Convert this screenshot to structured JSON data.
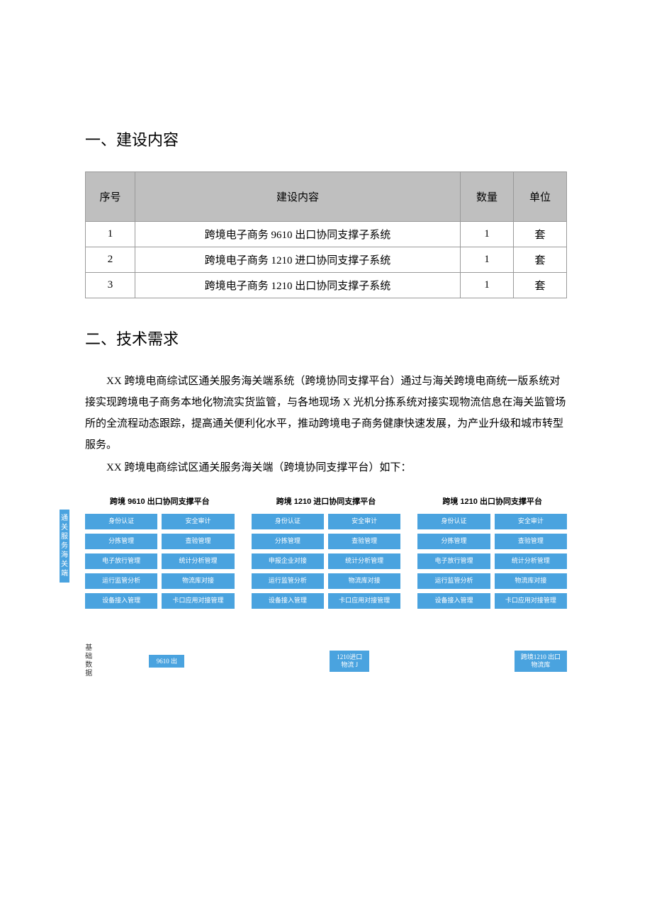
{
  "heading1": "一、建设内容",
  "table": {
    "headers": {
      "seq": "序号",
      "content": "建设内容",
      "qty": "数量",
      "unit": "单位"
    },
    "rows": [
      {
        "seq": "1",
        "content": "跨境电子商务 9610 出口协同支撑子系统",
        "qty": "1",
        "unit": "套"
      },
      {
        "seq": "2",
        "content": "跨境电子商务 1210 进口协同支撑子系统",
        "qty": "1",
        "unit": "套"
      },
      {
        "seq": "3",
        "content": "跨境电子商务 1210 出口协同支撑子系统",
        "qty": "1",
        "unit": "套"
      }
    ]
  },
  "heading2": "二、技术需求",
  "para1": "XX 跨境电商综试区通关服务海关端系统（跨境协同支撑平台）通过与海关跨境电商统一版系统对接实现跨境电子商务本地化物流实货监管，与各地现场 X 光机分拣系统对接实现物流信息在海关监管场所的全流程动态跟踪，提高通关便利化水平，推动跨境电子商务健康快速发展，为产业升级和城市转型服务。",
  "para2": "XX 跨境电商综试区通关服务海关端（跨境协同支撑平台）如下：",
  "sideLabel": "通关服务海关端",
  "platforms": [
    {
      "title": "跨境 9610 出口协同支撑平台",
      "modules": [
        "身份认证",
        "安全审计",
        "分拣管理",
        "查验管理",
        "电子放行管理",
        "统计分析管理",
        "运行监管分析",
        "物流库对接",
        "设备接入管理",
        "卡口应用对接管理"
      ]
    },
    {
      "title": "跨境 1210 进口协同支撑平台",
      "modules": [
        "身份认证",
        "安全审计",
        "分拣管理",
        "查验管理",
        "申报企业对接",
        "统计分析管理",
        "运行监管分析",
        "物流库对接",
        "设备接入管理",
        "卡口应用对接管理"
      ]
    },
    {
      "title": "跨境 1210 出口协同支撑平台",
      "modules": [
        "身份认证",
        "安全审计",
        "分拣管理",
        "查验管理",
        "电子放行管理",
        "统计分析管理",
        "运行监管分析",
        "物流库对接",
        "设备接入管理",
        "卡口应用对接管理"
      ]
    }
  ],
  "dbside": "基础数据",
  "db": [
    "9610 出",
    "1210进口物流 J",
    "跨境1210 出口物流库"
  ]
}
